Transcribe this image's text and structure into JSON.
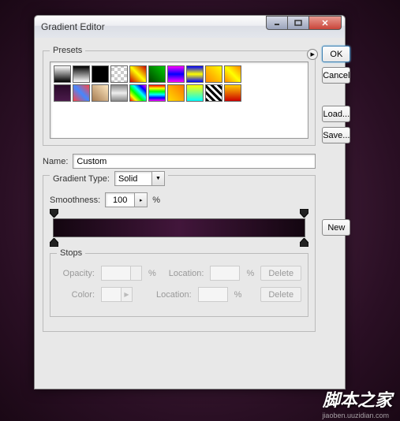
{
  "window": {
    "title": "Gradient Editor"
  },
  "buttons": {
    "ok": "OK",
    "cancel": "Cancel",
    "load": "Load...",
    "save": "Save...",
    "new": "New",
    "delete": "Delete"
  },
  "presets": {
    "legend": "Presets"
  },
  "name": {
    "label": "Name:",
    "value": "Custom"
  },
  "gradType": {
    "label": "Gradient Type:",
    "value": "Solid"
  },
  "smoothness": {
    "label": "Smoothness:",
    "value": "100",
    "unit": "%"
  },
  "stops": {
    "legend": "Stops",
    "opacity": "Opacity:",
    "location": "Location:",
    "color": "Color:",
    "pct": "%"
  },
  "swatches": [
    [
      "linear-gradient(#fff,#000)",
      "linear-gradient(#000,#fff)",
      "linear-gradient(#000,#000)",
      "repeating-conic-gradient(#ccc 0 25%,#fff 0 50%) 0/8px 8px",
      "linear-gradient(45deg,#c00,#ff0,#c00)",
      "linear-gradient(45deg,#040,#0c0)",
      "linear-gradient(#f0f,#00f,#f0f)",
      "linear-gradient(#00f,#ff0,#00f)",
      "linear-gradient(45deg,#f80,#ff0)",
      "linear-gradient(45deg,#f80,#ff0,#f80)"
    ],
    [
      "linear-gradient(#2a0a2a,#4a1a4a)",
      "linear-gradient(45deg,#f44,#48f,#f44)",
      "linear-gradient(45deg,#a67c52,#ffe8c0)",
      "linear-gradient(#888,#eee,#888)",
      "linear-gradient(45deg,#f00,#ff0,#0f0,#0ff,#00f,#f0f)",
      "linear-gradient(#f00,#ff0,#0f0,#0ff,#00f,#f0f)",
      "linear-gradient(45deg,#fd0,#f70)",
      "linear-gradient(#ff0,#0ff)",
      "repeating-linear-gradient(45deg,#000 0 3px,#fff 3px 6px)",
      "linear-gradient(#fc0,#c00)"
    ]
  ],
  "gradient": {
    "css": "linear-gradient(to right,#130610 0%,#42163b 50%,#130610 100%)",
    "stops": [
      {
        "pos": 0,
        "color": "#130610"
      },
      {
        "pos": 50,
        "color": "#42163b"
      },
      {
        "pos": 100,
        "color": "#130610"
      }
    ]
  },
  "watermark": {
    "main": "脚本之家",
    "sub": "jiaoben.uuzidian.com"
  }
}
